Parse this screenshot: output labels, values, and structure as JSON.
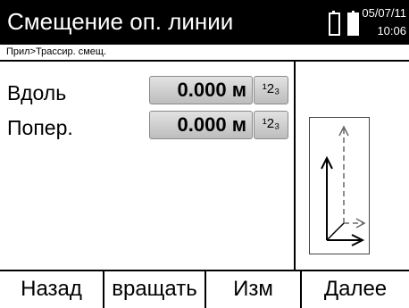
{
  "header": {
    "title": "Смещение оп. линии",
    "date": "05/07/11",
    "time": "10:06",
    "battery_icon": "battery-icon"
  },
  "breadcrumb": "Прил>Трассир. смещ.",
  "fields": [
    {
      "label": "Вдоль",
      "value": "0.000",
      "unit": "м",
      "unit_button": "¹2₃"
    },
    {
      "label": "Попер.",
      "value": "0.000",
      "unit": "м",
      "unit_button": "¹2₃"
    }
  ],
  "diagram": {
    "icon": "offset-axes-diagram-icon"
  },
  "softkeys": [
    "Назад",
    "вращать",
    "Изм",
    "Далее"
  ]
}
